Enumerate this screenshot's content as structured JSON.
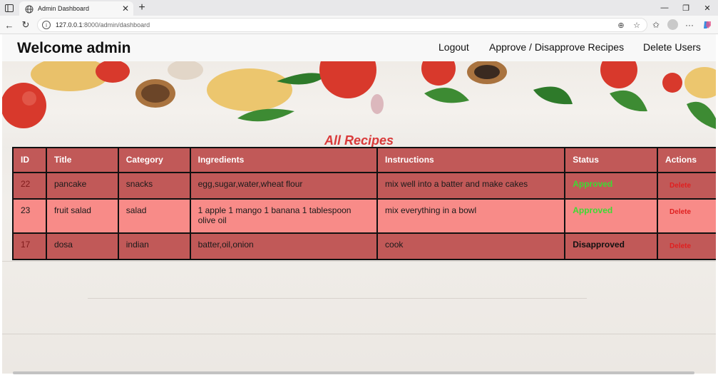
{
  "browser": {
    "tab_title": "Admin Dashboard",
    "url_host": "127.0.0.1",
    "url_rest": ":8000/admin/dashboard"
  },
  "page": {
    "brand": "Welcome admin",
    "nav": [
      "Logout",
      "Approve / Disapprove Recipes",
      "Delete Users"
    ],
    "heading": "All Recipes",
    "table": {
      "columns": [
        "ID",
        "Title",
        "Category",
        "Ingredients",
        "Instructions",
        "Status",
        "Actions"
      ],
      "rows": [
        {
          "id": "22",
          "title": "pancake",
          "category": "snacks",
          "ingredients": "egg,sugar,water,wheat flour",
          "instructions": "mix well into a batter and make cakes",
          "status": "Approved",
          "action": "Delete"
        },
        {
          "id": "23",
          "title": "fruit salad",
          "category": "salad",
          "ingredients": "1 apple 1 mango 1 banana 1 tablespoon olive oil",
          "instructions": "mix everything in a bowl",
          "status": "Approved",
          "action": "Delete"
        },
        {
          "id": "17",
          "title": "dosa",
          "category": "indian",
          "ingredients": "batter,oil,onion",
          "instructions": "cook",
          "status": "Disapproved",
          "action": "Delete"
        }
      ]
    }
  },
  "colors": {
    "header_row": "#c15958",
    "row_odd": "#c15958",
    "row_even": "#f88b88",
    "approved": "#3ddc33",
    "disapproved": "#111111",
    "delete": "#e02020",
    "heading": "#d93a3a"
  },
  "icons": [
    "sidebar-toggle-icon",
    "globe-icon",
    "close-icon",
    "plus-icon",
    "minimize-icon",
    "restore-icon",
    "window-close-icon",
    "back-icon",
    "reload-icon",
    "info-icon",
    "zoom-icon",
    "star-icon",
    "favorites-icon",
    "profile-icon",
    "more-icon",
    "copilot-icon"
  ]
}
